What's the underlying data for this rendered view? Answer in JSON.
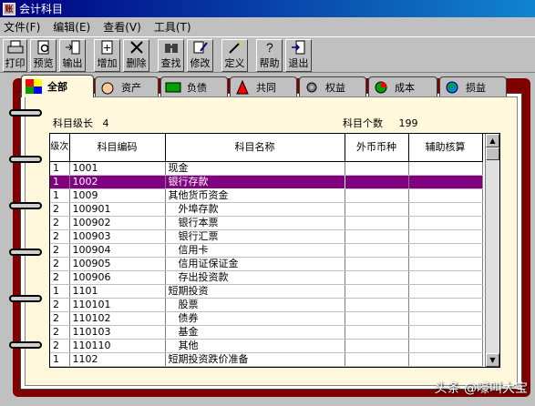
{
  "window": {
    "title": "会计科目"
  },
  "menu": [
    "文件(F)",
    "编辑(E)",
    "查看(V)",
    "工具(T)"
  ],
  "toolbar": [
    "打印",
    "预览",
    "输出",
    "增加",
    "删除",
    "查找",
    "修改",
    "定义",
    "帮助",
    "退出"
  ],
  "tabs": [
    "全部",
    "资产",
    "负债",
    "共同",
    "权益",
    "成本",
    "损益"
  ],
  "info": {
    "level_label": "科目级长",
    "level_value": "4",
    "count_label": "科目个数",
    "count_value": "199"
  },
  "table": {
    "headers": [
      "级次",
      "科目编码",
      "科目名称",
      "外币币种",
      "辅助核算"
    ],
    "rows": [
      {
        "level": "1",
        "code": "1001",
        "name": "现金"
      },
      {
        "level": "1",
        "code": "1002",
        "name": "银行存款"
      },
      {
        "level": "1",
        "code": "1009",
        "name": "其他货币资金"
      },
      {
        "level": "2",
        "code": "100901",
        "name": "外埠存款"
      },
      {
        "level": "2",
        "code": "100902",
        "name": "银行本票"
      },
      {
        "level": "2",
        "code": "100903",
        "name": "银行汇票"
      },
      {
        "level": "2",
        "code": "100904",
        "name": "信用卡"
      },
      {
        "level": "2",
        "code": "100905",
        "name": "信用证保证金"
      },
      {
        "level": "2",
        "code": "100906",
        "name": "存出投资款"
      },
      {
        "level": "1",
        "code": "1101",
        "name": "短期投资"
      },
      {
        "level": "2",
        "code": "110101",
        "name": "股票"
      },
      {
        "level": "2",
        "code": "110102",
        "name": "债券"
      },
      {
        "level": "2",
        "code": "110103",
        "name": "基金"
      },
      {
        "level": "2",
        "code": "110110",
        "name": "其他"
      },
      {
        "level": "1",
        "code": "1102",
        "name": "短期投资跌价准备"
      }
    ]
  },
  "watermark": "头条 @嚎叫大宝"
}
